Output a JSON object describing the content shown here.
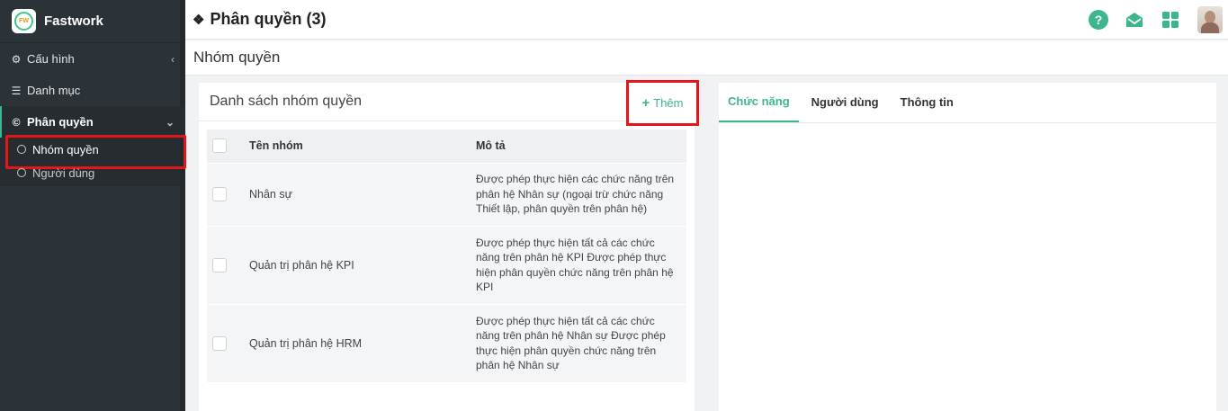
{
  "sidebar": {
    "brand": "Fastwork",
    "logo_text": "FW",
    "items": [
      {
        "label": "Cấu hình",
        "icon": "gear-icon"
      },
      {
        "label": "Danh mục",
        "icon": "list-icon"
      },
      {
        "label": "Phân quyền",
        "icon": "copyright-icon"
      }
    ],
    "submenu": [
      {
        "label": "Nhóm quyền"
      },
      {
        "label": "Người dùng"
      }
    ]
  },
  "header": {
    "title": "Phân quyền (3)",
    "help_glyph": "?"
  },
  "subheader": {
    "title": "Nhóm quyền"
  },
  "list_panel": {
    "title": "Danh sách nhóm quyền",
    "add_label": "Thêm",
    "columns": [
      "Tên nhóm",
      "Mô tả"
    ],
    "rows": [
      {
        "name": "Nhân sự",
        "description": "Được phép thực hiện các chức năng trên phân hệ Nhân sự (ngoại trừ chức năng Thiết lập, phân quyền trên phân hệ)"
      },
      {
        "name": "Quản trị phân hệ KPI",
        "description": "Được phép thực hiện tất cả các chức năng trên phân hệ KPI Được phép thực hiện phân quyền chức năng trên phân hệ KPI"
      },
      {
        "name": "Quản trị phân hệ HRM",
        "description": "Được phép thực hiện tất cả các chức năng trên phân hệ Nhân sự Được phép thực hiện phân quyền chức năng trên phân hệ Nhân sự"
      }
    ]
  },
  "detail_panel": {
    "tabs": [
      {
        "label": "Chức năng"
      },
      {
        "label": "Người dùng"
      },
      {
        "label": "Thông tin"
      }
    ]
  },
  "colors": {
    "accent": "#3cb68e",
    "sidebar_bg": "#2c3338",
    "highlight_box": "#e3161b"
  }
}
